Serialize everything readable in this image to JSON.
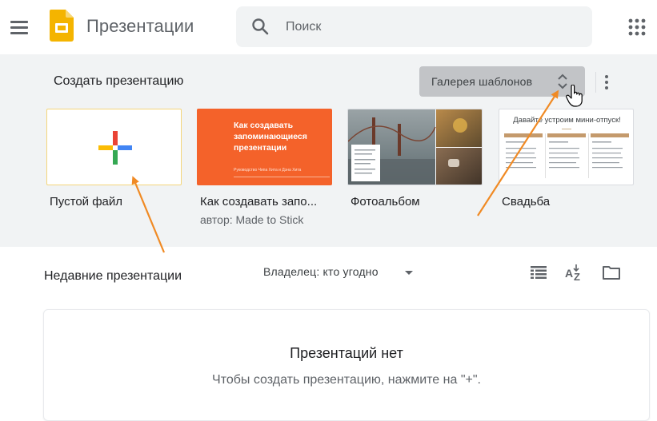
{
  "header": {
    "app_title": "Презентации",
    "search_placeholder": "Поиск"
  },
  "templates": {
    "section_title": "Создать презентацию",
    "gallery_label": "Галерея шаблонов",
    "items": [
      {
        "name": "Пустой файл",
        "author": ""
      },
      {
        "name": "Как создавать запо...",
        "author": "автор: Made to Stick",
        "thumb_title": "Как создавать запоминающиеся презентации",
        "thumb_subtitle": "Руководство Чипа Хита и Дэна Хита"
      },
      {
        "name": "Фотоальбом",
        "author": ""
      },
      {
        "name": "Свадьба",
        "author": "",
        "thumb_title": "Давайте устроим мини-отпуск!"
      }
    ]
  },
  "recent": {
    "title": "Недавние презентации",
    "owner_filter": "Владелец: кто угодно"
  },
  "empty_state": {
    "title": "Презентаций нет",
    "subtitle": "Чтобы создать презентацию, нажмите на \"+\"."
  },
  "colors": {
    "slides_yellow": "#f4b400",
    "template_orange": "#f4622a",
    "annotation_arrow": "#f08a24",
    "panel_bg": "#f1f3f4"
  }
}
